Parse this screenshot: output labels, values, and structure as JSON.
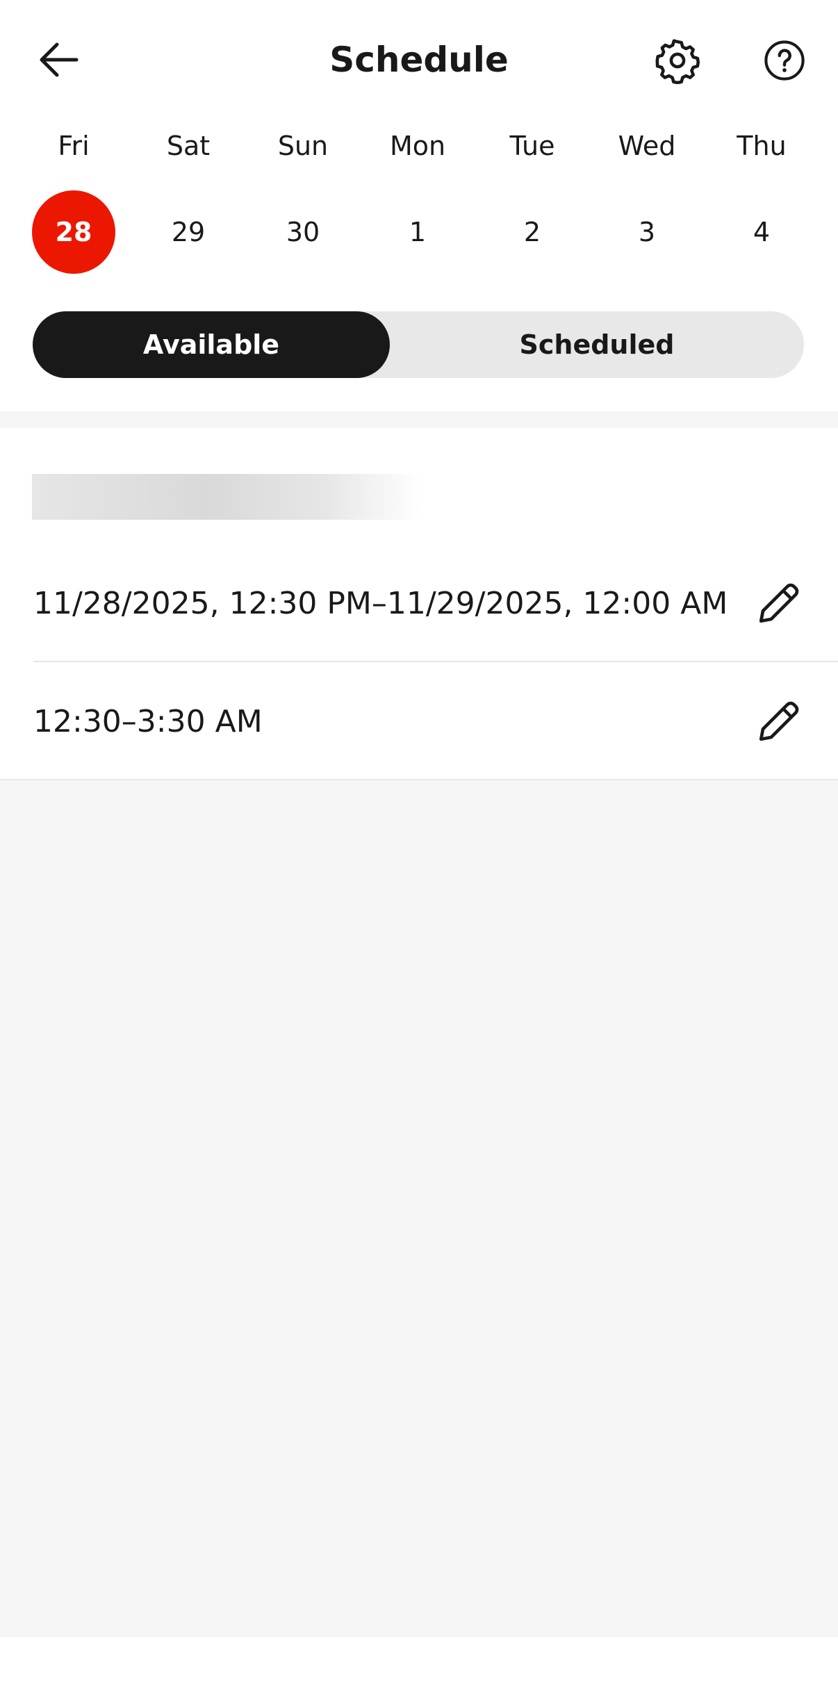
{
  "header": {
    "title": "Schedule",
    "back_icon": "arrow-left-icon",
    "settings_icon": "gear-icon",
    "help_icon": "question-circle-icon"
  },
  "week": {
    "days": [
      {
        "weekday": "Fri",
        "date": "28",
        "selected": true
      },
      {
        "weekday": "Sat",
        "date": "29",
        "selected": false
      },
      {
        "weekday": "Sun",
        "date": "30",
        "selected": false
      },
      {
        "weekday": "Mon",
        "date": "1",
        "selected": false
      },
      {
        "weekday": "Tue",
        "date": "2",
        "selected": false
      },
      {
        "weekday": "Wed",
        "date": "3",
        "selected": false
      },
      {
        "weekday": "Thu",
        "date": "4",
        "selected": false
      }
    ],
    "selected_color": "#eb1700"
  },
  "segmented": {
    "available_label": "Available",
    "scheduled_label": "Scheduled",
    "active": "Available"
  },
  "slots": [
    {
      "text": "11/28/2025, 12:30 PM–11/29/2025, 12:00 AM",
      "icon": "pencil-icon"
    },
    {
      "text": "12:30–3:30 AM",
      "icon": "pencil-icon"
    }
  ],
  "colors": {
    "accent": "#eb1700",
    "dark": "#191919",
    "background_gray": "#f5f5f5"
  }
}
